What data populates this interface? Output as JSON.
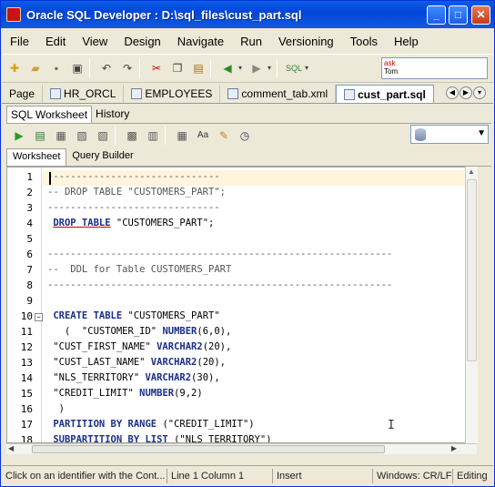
{
  "window": {
    "title": "Oracle SQL Developer : D:\\sql_files\\cust_part.sql",
    "min": "_",
    "max": "□",
    "close": "✕"
  },
  "menu": [
    "File",
    "Edit",
    "View",
    "Design",
    "Navigate",
    "Run",
    "Versioning",
    "Tools",
    "Help"
  ],
  "ask": {
    "line1": "ask",
    "line2": "Tom"
  },
  "doc_tabs": [
    {
      "label": "Page",
      "icon": "page-icon"
    },
    {
      "label": "HR_ORCL",
      "icon": "sql-icon"
    },
    {
      "label": "EMPLOYEES",
      "icon": "table-icon"
    },
    {
      "label": "comment_tab.xml",
      "icon": "xml-icon"
    },
    {
      "label": "cust_part.sql",
      "icon": "sql-file-icon",
      "active": true
    }
  ],
  "worksheet_tabs": [
    "SQL Worksheet",
    "History"
  ],
  "sub_tabs": [
    "Worksheet",
    "Query Builder"
  ],
  "code_lines": [
    {
      "n": "1",
      "t": "------------------------------",
      "c": "cm"
    },
    {
      "n": "2",
      "t": "-- DROP TABLE \"CUSTOMERS_PART\";",
      "c": "cm"
    },
    {
      "n": "3",
      "t": "------------------------------",
      "c": "cm"
    },
    {
      "n": "4",
      "t": " DROP TABLE \"CUSTOMERS_PART\";",
      "c": ""
    },
    {
      "n": "5",
      "t": "",
      "c": ""
    },
    {
      "n": "6",
      "t": "------------------------------------------------------------",
      "c": "cm"
    },
    {
      "n": "7",
      "t": "--  DDL for Table CUSTOMERS_PART",
      "c": "cm"
    },
    {
      "n": "8",
      "t": "------------------------------------------------------------",
      "c": "cm"
    },
    {
      "n": "9",
      "t": "",
      "c": ""
    },
    {
      "n": "10",
      "t": " CREATE TABLE \"CUSTOMERS_PART\"",
      "c": ""
    },
    {
      "n": "11",
      "t": "   (  \"CUSTOMER_ID\" NUMBER(6,0),",
      "c": ""
    },
    {
      "n": "12",
      "t": " \"CUST_FIRST_NAME\" VARCHAR2(20),",
      "c": ""
    },
    {
      "n": "13",
      "t": " \"CUST_LAST_NAME\" VARCHAR2(20),",
      "c": ""
    },
    {
      "n": "14",
      "t": " \"NLS_TERRITORY\" VARCHAR2(30),",
      "c": ""
    },
    {
      "n": "15",
      "t": " \"CREDIT_LIMIT\" NUMBER(9,2)",
      "c": ""
    },
    {
      "n": "16",
      "t": "  )",
      "c": ""
    },
    {
      "n": "17",
      "t": " PARTITION BY RANGE (\"CREDIT_LIMIT\")",
      "c": ""
    },
    {
      "n": "18",
      "t": " SUBPARTITION BY LIST (\"NLS_TERRITORY\")",
      "c": ""
    }
  ],
  "status": {
    "hint": "Click on an identifier with the Cont...",
    "position": "Line 1 Column 1",
    "mode": "Insert",
    "eol": "Windows: CR/LF",
    "state": "Editing"
  }
}
